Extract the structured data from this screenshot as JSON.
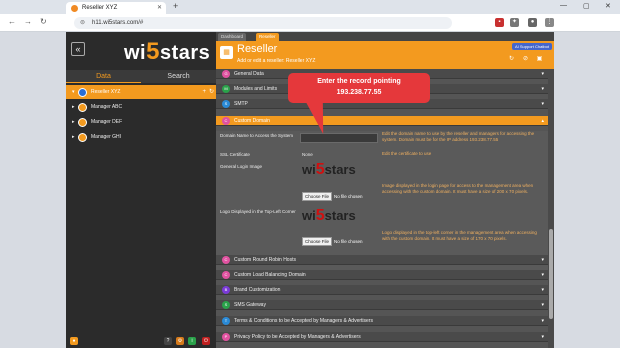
{
  "browser": {
    "tab_title": "Reseller XYZ",
    "url": "h11.wi5stars.com/#"
  },
  "sidebar": {
    "logo_text_a": "wi",
    "logo_text_five": "5",
    "logo_text_b": "stars",
    "tabs": [
      "Data",
      "Search"
    ],
    "tree": [
      {
        "label": "Reseller XYZ",
        "selected": true
      },
      {
        "label": "Manager ABC",
        "selected": false
      },
      {
        "label": "Manager DEF",
        "selected": false
      },
      {
        "label": "Manager GHI",
        "selected": false
      }
    ]
  },
  "main": {
    "tabs": [
      "Dashboard",
      "Reseller"
    ],
    "title": "Reseller",
    "subtitle": "Add or edit a reseller: Reseller XYZ",
    "announcement": "AI Support Chatbot",
    "sections_top": [
      {
        "label": "General Data",
        "color": "#e052a0"
      },
      {
        "label": "Modules and Limits",
        "color": "#2aa24a"
      },
      {
        "label": "SMTP",
        "color": "#2a8ad6"
      }
    ],
    "open_section": {
      "label": "Custom Domain",
      "color": "#e052a0"
    },
    "form": {
      "domain_label": "Domain Name to Access the System",
      "domain_value": "",
      "domain_help": "Edit the domain name to use by the reseller and managers for accessing the system. Domain must be for the IP address 193.238.77.55",
      "ssl_label": "SSL Certificate",
      "ssl_value": "None",
      "ssl_help": "Edit the certificate to use",
      "login_image_label": "General Login Image",
      "login_image_help": "Image displayed in the login page for access to the management area when accessing with the custom domain. It must have a size of 200 x 70 pixels.",
      "logo_top_label": "Logo Displayed in the Top-Left Corner",
      "logo_top_help": "Logo displayed in the top-left corner in the management area when accessing with the custom domain. It must have a size of 170 x 70 pixels.",
      "choose_file": "Choose File",
      "no_file": "No file chosen"
    },
    "sections_bottom": [
      {
        "label": "Custom Round Robin Hosts",
        "color": "#e052a0"
      },
      {
        "label": "Custom Load Balancing Domain",
        "color": "#e052a0"
      },
      {
        "label": "Brand Customization",
        "color": "#7a3ad6"
      },
      {
        "label": "SMS Gateway",
        "color": "#2aa24a"
      },
      {
        "label": "Terms & Conditions to be Accepted by Managers & Advertisers",
        "color": "#2a8ad6"
      },
      {
        "label": "Privacy Policy to be Accepted by Managers & Advertisers",
        "color": "#e052a0"
      }
    ]
  },
  "callout": {
    "line1": "Enter the record pointing",
    "line2": "193.238.77.55"
  },
  "colors": {
    "accent": "#f39a1f",
    "callout": "#e5383b"
  }
}
